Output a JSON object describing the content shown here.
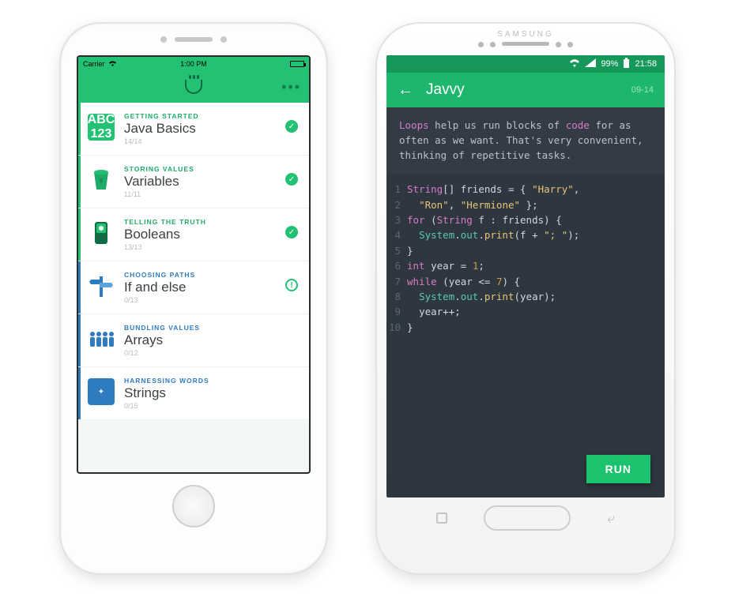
{
  "iphone": {
    "status": {
      "carrier": "Carrier",
      "time": "1:00 PM"
    },
    "lessons": [
      {
        "eyebrow": "GETTING STARTED",
        "title": "Java Basics",
        "progress": "14/14",
        "status": "check",
        "theme": "green",
        "icon": "basics"
      },
      {
        "eyebrow": "STORING VALUES",
        "title": "Variables",
        "progress": "11/11",
        "status": "check",
        "theme": "green",
        "icon": "bucket"
      },
      {
        "eyebrow": "TELLING THE TRUTH",
        "title": "Booleans",
        "progress": "13/13",
        "status": "check",
        "theme": "green",
        "icon": "bool"
      },
      {
        "eyebrow": "CHOOSING PATHS",
        "title": "If and else",
        "progress": "0/13",
        "status": "exclaim",
        "theme": "blue",
        "icon": "sign"
      },
      {
        "eyebrow": "BUNDLING VALUES",
        "title": "Arrays",
        "progress": "0/12",
        "status": "none",
        "theme": "blue",
        "icon": "people"
      },
      {
        "eyebrow": "HARNESSING WORDS",
        "title": "Strings",
        "progress": "0/15",
        "status": "none",
        "theme": "blue",
        "icon": "ball"
      }
    ]
  },
  "samsung": {
    "status": {
      "battery": "99%",
      "time": "21:58"
    },
    "nav": {
      "title": "Javvy",
      "date": "09-14"
    },
    "explain_plain": "Loops help us run blocks of code for as often as we want. That's very convenient, thinking of repetitive tasks.",
    "explain_highlights": [
      "Loops",
      "code"
    ],
    "code_lines": [
      "String[] friends = { \"Harry\",",
      "  \"Ron\", \"Hermione\" };",
      "for (String f : friends) {",
      "  System.out.print(f + \"; \");",
      "}",
      "int year = 1;",
      "while (year <= 7) {",
      "  System.out.print(year);",
      "  year++;",
      "}"
    ],
    "run_label": "RUN"
  },
  "colors": {
    "green": "#22c173",
    "blue": "#2f7bbf",
    "code_bg": "#2e3740"
  }
}
